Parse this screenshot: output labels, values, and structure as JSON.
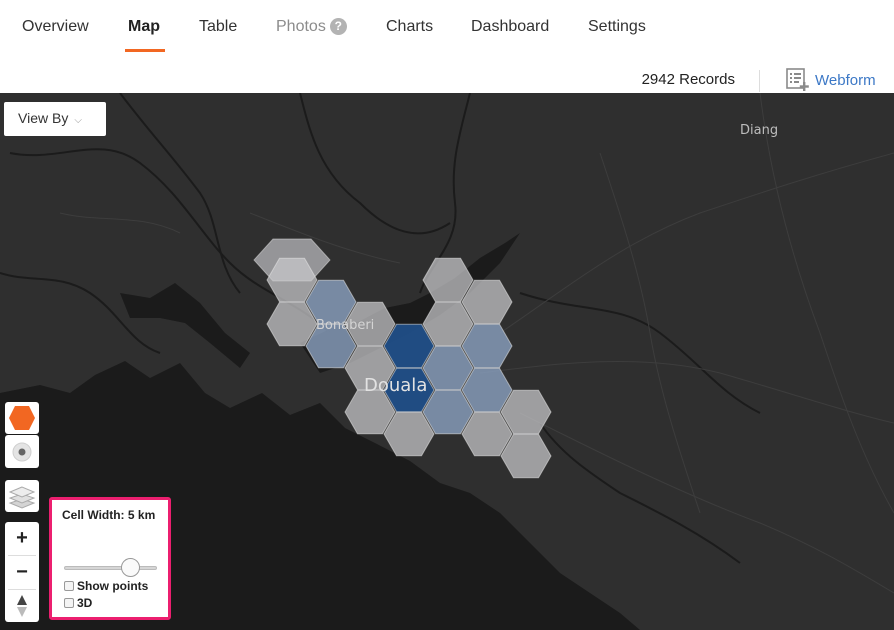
{
  "nav": {
    "tabs": [
      {
        "label": "Overview"
      },
      {
        "label": "Map"
      },
      {
        "label": "Table"
      },
      {
        "label": "Photos"
      },
      {
        "label": "Charts"
      },
      {
        "label": "Dashboard"
      },
      {
        "label": "Settings"
      }
    ],
    "active_tab": "Map",
    "photos_help": "?"
  },
  "records": {
    "count_label": "2942 Records",
    "webform_label": "Webform"
  },
  "map": {
    "view_by_label": "View By",
    "places": [
      "Diang",
      "Bonaberi",
      "Douala"
    ],
    "controls": {
      "hex_icon": "hexagon-icon",
      "point_icon": "point-icon",
      "layers_icon": "layers-icon",
      "zoom_in": "+",
      "zoom_out": "−",
      "compass": "compass-icon"
    }
  },
  "cell_panel": {
    "title": "Cell Width: 5 km",
    "slider_value_km": 5,
    "show_points_label": "Show points",
    "show_points_checked": false,
    "threed_label": "3D",
    "threed_checked": false
  },
  "colors": {
    "accent": "#f26722",
    "link": "#3c78c6",
    "highlight_border": "#ec1f6f",
    "map_background": "#2f2f2f",
    "water": "#1b1b1b",
    "hex_light": "#c9c9cc",
    "hex_mid": "#8da4c4",
    "hex_dark": "#1f4f8a"
  }
}
